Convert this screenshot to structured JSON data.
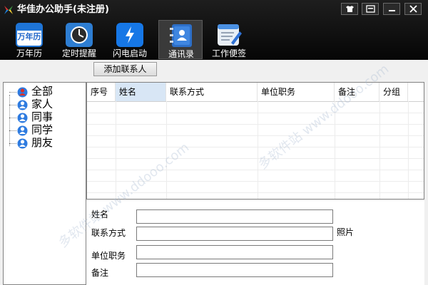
{
  "app": {
    "title": "华佳办公助手(未注册)"
  },
  "nav": [
    {
      "label": "万年历",
      "icon_text": "万年历"
    },
    {
      "label": "定时提醒"
    },
    {
      "label": "闪电启动"
    },
    {
      "label": "通讯录"
    },
    {
      "label": "工作便签"
    }
  ],
  "toolbar": {
    "add_contact_label": "添加联系人"
  },
  "tree": {
    "items": [
      {
        "label": "全部"
      },
      {
        "label": "家人"
      },
      {
        "label": "同事"
      },
      {
        "label": "同学"
      },
      {
        "label": "朋友"
      }
    ]
  },
  "table": {
    "columns": [
      "序号",
      "姓名",
      "联系方式",
      "单位职务",
      "备注",
      "分组"
    ],
    "rows": []
  },
  "form": {
    "name_label": "姓名",
    "contact_label": "联系方式",
    "title_label": "单位职务",
    "note_label": "备注",
    "photo_label": "照片",
    "name_value": "",
    "contact_value": "",
    "title_value": "",
    "note_value": ""
  },
  "watermark": {
    "text": "多软件站 www.ddooo.com"
  },
  "colors": {
    "titlebar": "#0a0a0a",
    "selected_header": "#d8e6f5",
    "user_icon_blue": "#2e7be0",
    "user_icon_red": "#d9312b"
  }
}
